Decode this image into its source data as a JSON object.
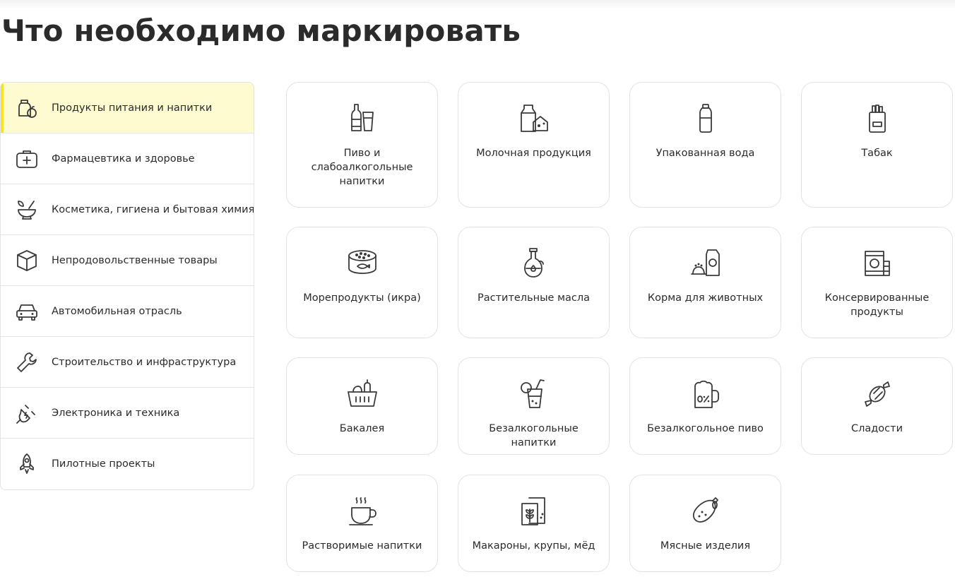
{
  "page": {
    "title": "Что необходимо маркировать"
  },
  "sidebar": {
    "items": [
      {
        "label": "Продукты питания и напитки",
        "icon": "grocery-jar-icon",
        "active": true
      },
      {
        "label": "Фармацевтика и здоровье",
        "icon": "first-aid-kit-icon",
        "active": false
      },
      {
        "label": "Косметика, гигиена и бытовая химия",
        "icon": "mortar-leaf-icon",
        "active": false
      },
      {
        "label": "Непродовольственные товары",
        "icon": "box-icon",
        "active": false
      },
      {
        "label": "Автомобильная отрасль",
        "icon": "car-icon",
        "active": false
      },
      {
        "label": "Строительство и инфраструктура",
        "icon": "wrench-icon",
        "active": false
      },
      {
        "label": "Электроника и техника",
        "icon": "plug-icon",
        "active": false
      },
      {
        "label": "Пилотные проекты",
        "icon": "rocket-icon",
        "active": false
      }
    ]
  },
  "categories": [
    {
      "label": "Пиво и слабоалкогольные напитки",
      "icon": "beer-bottle-glass-icon"
    },
    {
      "label": "Молочная продукция",
      "icon": "milk-cheese-icon"
    },
    {
      "label": "Упакованная вода",
      "icon": "water-bottle-icon"
    },
    {
      "label": "Табак",
      "icon": "cigarette-pack-icon"
    },
    {
      "label": "Морепродукты (икра)",
      "icon": "caviar-can-icon"
    },
    {
      "label": "Растительные масла",
      "icon": "oil-bottle-icon"
    },
    {
      "label": "Корма для животных",
      "icon": "pet-food-icon"
    },
    {
      "label": "Консервированные продукты",
      "icon": "canned-food-icon"
    },
    {
      "label": "Бакалея",
      "icon": "grocery-basket-icon"
    },
    {
      "label": "Безалкогольные напитки",
      "icon": "soft-drink-icon"
    },
    {
      "label": "Безалкогольное пиво",
      "icon": "zero-percent-beer-icon"
    },
    {
      "label": "Сладости",
      "icon": "candy-icon"
    },
    {
      "label": "Растворимые напитки",
      "icon": "hot-cup-icon"
    },
    {
      "label": "Макароны, крупы, мёд",
      "icon": "grain-pack-icon"
    },
    {
      "label": "Мясные изделия",
      "icon": "sausage-icon"
    }
  ],
  "colors": {
    "active_background": "#fdfbcf",
    "active_accent": "#f4e52a",
    "border": "#e3e3e3",
    "text": "#2b2b2b"
  }
}
